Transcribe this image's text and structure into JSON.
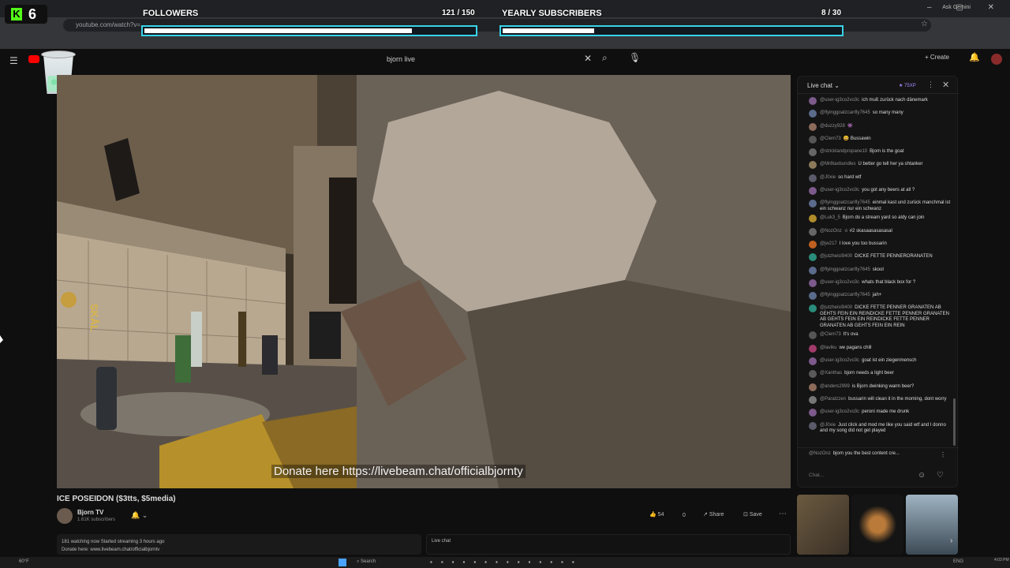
{
  "browser": {
    "address": "youtube.com/watch?v=...",
    "ask_gemini": "Ask Gemini",
    "window_controls": "– ▢ ✕"
  },
  "overlay": {
    "kick_count": "6",
    "kick_logo": "K",
    "followers": {
      "label": "FOLLOWERS",
      "count": "121 / 150",
      "fraction": 0.81
    },
    "subscribers": {
      "label": "YEARLY SUBSCRIBERS",
      "count": "8 / 30",
      "fraction": 0.27
    },
    "kick_color": "#53fc18",
    "bar_border_color": "#3ad3e8"
  },
  "masthead": {
    "search_value": "bjorn live",
    "create_label": "+ Create"
  },
  "video": {
    "caption": "Donate here https://livebeam.chat/officialbjornty",
    "sticker_text": "SKÅL"
  },
  "meta": {
    "title": "ICE POSEIDON ($3tts, $5media)",
    "channel": "Bjorn TV",
    "subs": "1.61K subscribers",
    "likes": "54",
    "dislikes": "0",
    "share": "Share",
    "save": "Save",
    "desc_line1": "181 watching now  Started streaming 3 hours ago",
    "desc_line2": "Donate here: www.livebeam.chat/officialbjorntv",
    "livechat_label": "Live chat"
  },
  "chat": {
    "title": "Live chat ⌄",
    "xp": "★ 75XP",
    "messages": [
      {
        "author": "@user-ig3co2vo3c",
        "text": "ich muß zurück nach dänemark",
        "color": "#7d5a8c"
      },
      {
        "author": "@flyinggoatzcanfly7645",
        "text": "so many many",
        "color": "#5a6b8c"
      },
      {
        "author": "@duzzy928",
        "text": "👾",
        "color": "#8c6b5a"
      },
      {
        "author": "@Clem73",
        "text": "😃 Bussawin",
        "color": "#555555"
      },
      {
        "author": "@stricklandpropane10",
        "text": "Bjorn is the goat",
        "color": "#666666"
      },
      {
        "author": "@Mr8taxbundles",
        "text": "U better go tell her ya shtanker",
        "color": "#8c7a5a"
      },
      {
        "author": "@J0xie",
        "text": "so hard wtf",
        "color": "#5a5a6b"
      },
      {
        "author": "@user-ig3co2vo3c",
        "text": "you got any beers at all ?",
        "color": "#7d5a8c"
      },
      {
        "author": "@flyinggoatzcanfly7645",
        "text": "einmal kast und zurück manchmal ist ein schwanz nur ein schwanz",
        "color": "#5a6b8c"
      },
      {
        "author": "@Luk3_5",
        "text": "Bjorn do a stream yard so aldy can join",
        "color": "#b08c2a"
      },
      {
        "author": "@NozOnz",
        "text": "☆ #2  skasaasasasasal",
        "color": "#666666"
      },
      {
        "author": "@jw217",
        "text": "I love you too bussarin",
        "color": "#c06020"
      },
      {
        "author": "@jutzheisl9400",
        "text": "DICKE FETTE PENNERORANATEN",
        "color": "#2a8c7a"
      },
      {
        "author": "@flyinggoatzcanfly7645",
        "text": "skool",
        "color": "#5a6b8c"
      },
      {
        "author": "@user-ig3co2vo3c",
        "text": "whats that black box for ?",
        "color": "#7d5a8c"
      },
      {
        "author": "@flyinggoatzcanfly7645",
        "text": "jah+",
        "color": "#5a6b8c"
      },
      {
        "author": "@jutzheisl9400",
        "text": "DICKE FETTE PENNER GRANATEN AB GEHTS FEIN EIN REINDICKE FETTE PENNER GRANATEN AB GEHTS FEIN EIN REINDICKE FETTE PENNER GRANATEN AB GEHTS FEIN EIN REIN",
        "color": "#2a8c7a"
      },
      {
        "author": "@Clem73",
        "text": "It's ova",
        "color": "#555555"
      },
      {
        "author": "@laviku",
        "text": "we pagans chill",
        "color": "#a03a6b"
      },
      {
        "author": "@user-ig3co2vo3c",
        "text": "goat ist ein ziegenmensch",
        "color": "#7d5a8c"
      },
      {
        "author": "@Xanthas",
        "text": "bjorn needs a light beer",
        "color": "#5a5a5a"
      },
      {
        "author": "@anders2999",
        "text": "is Bjorn dwinking warm beer?",
        "color": "#8c6b5a"
      },
      {
        "author": "@Paratzzen",
        "text": "bussarin will clean it in the morning, dont worry",
        "color": "#777777"
      },
      {
        "author": "@user-ig3co2vo3c",
        "text": "peroni made me drunk",
        "color": "#7d5a8c"
      },
      {
        "author": "@J0xie",
        "text": "Just click and mod me like you said wtf and I donno and my song did not get played",
        "color": "#5a5a6b"
      }
    ],
    "pinned": {
      "author": "@NozOnz",
      "text": "bjorn you the best content cre..."
    },
    "input_placeholder": "Chat..."
  },
  "taskbar": {
    "weather": "60°F",
    "search": "Search",
    "lang": "ENG",
    "time": "4:03 PM"
  },
  "icons": [
    "menu-icon",
    "youtube-logo-icon",
    "close-icon",
    "search-icon",
    "mic-icon",
    "bell-icon",
    "like-icon",
    "share-icon",
    "save-icon",
    "more-icon",
    "emoji-icon",
    "heart-icon",
    "chevron-right-icon"
  ]
}
